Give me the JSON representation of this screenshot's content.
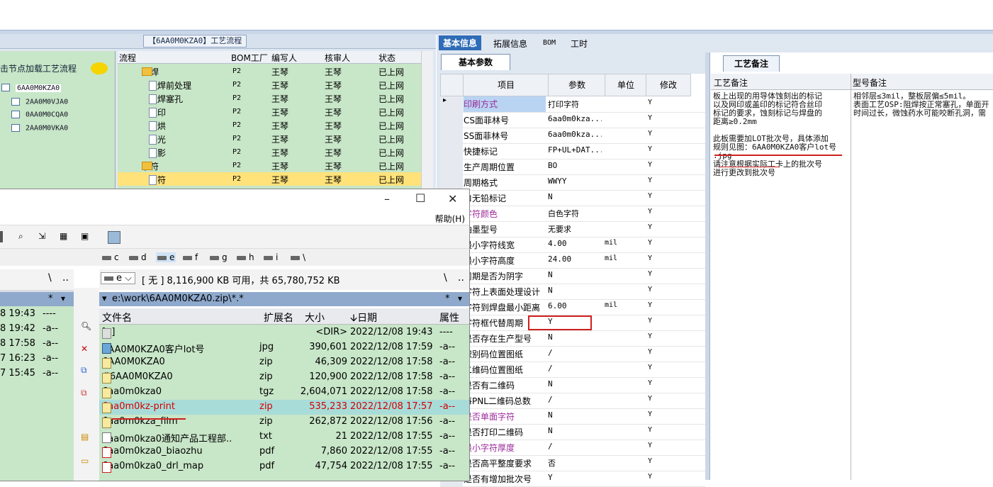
{
  "process_panel": {
    "title": "【6AA0M0KZA0】工艺流程",
    "left_hint": "击节点加载工艺流程",
    "tree": [
      "6AA0M0KZA0",
      "2AA0M0VJA0",
      "0AA0M0CQA0",
      "2AA0M0VKA0"
    ],
    "columns": [
      "流程",
      "BOM工厂",
      "编写人",
      "核审人",
      "状态"
    ],
    "rows": [
      {
        "name": "阻焊",
        "plant": "P2",
        "author": "王琴",
        "reviewer": "王琴",
        "status": "已上网"
      },
      {
        "name": "阻焊前处理",
        "plant": "P2",
        "author": "王琴",
        "reviewer": "王琴",
        "status": "已上网"
      },
      {
        "name": "阻焊塞孔",
        "plant": "P2",
        "author": "王琴",
        "reviewer": "王琴",
        "status": "已上网"
      },
      {
        "name": "丝印",
        "plant": "P2",
        "author": "王琴",
        "reviewer": "王琴",
        "status": "已上网"
      },
      {
        "name": "预烘",
        "plant": "P2",
        "author": "王琴",
        "reviewer": "王琴",
        "status": "已上网"
      },
      {
        "name": "曝光",
        "plant": "P2",
        "author": "王琴",
        "reviewer": "王琴",
        "status": "已上网"
      },
      {
        "name": "显影",
        "plant": "P2",
        "author": "王琴",
        "reviewer": "王琴",
        "status": "已上网"
      },
      {
        "name": "字符",
        "plant": "P2",
        "author": "王琴",
        "reviewer": "王琴",
        "status": "已上网"
      },
      {
        "name": "字符",
        "plant": "P2",
        "author": "王琴",
        "reviewer": "王琴",
        "status": "已上网"
      }
    ]
  },
  "file_manager": {
    "help_menu": "帮助(H)",
    "drives": [
      "c",
      "d",
      "e",
      "f",
      "g",
      "h",
      "i",
      "\\"
    ],
    "drive_select": "e",
    "free_space": "[ 无 ]  8,116,900 KB 可用，共 65,780,752 KB",
    "path": "e:\\work\\6AA0M0KZA0.zip\\*.*",
    "nav_root": "\\",
    "nav_up": "..",
    "filter": "*",
    "columns": {
      "name": "文件名",
      "ext": "扩展名",
      "size": "大小",
      "date": "日期",
      "attr": "属性"
    },
    "left_attr_header": "属性",
    "left_rows": [
      {
        "date": "8 19:43",
        "attr": "----"
      },
      {
        "date": "8 19:42",
        "attr": "-a--"
      },
      {
        "date": "8 17:58",
        "attr": "-a--"
      },
      {
        "date": "7 16:23",
        "attr": "-a--"
      },
      {
        "date": "7 15:45",
        "attr": "-a--"
      }
    ],
    "files": [
      {
        "name": "[..]",
        "ext": "",
        "size": "<DIR>",
        "date": "2022/12/08 19:43",
        "attr": "----"
      },
      {
        "name": "6AA0M0KZA0客户lot号",
        "ext": "jpg",
        "size": "390,601",
        "date": "2022/12/08 17:59",
        "attr": "-a--"
      },
      {
        "name": "6AA0M0KZA0",
        "ext": "zip",
        "size": "46,309",
        "date": "2022/12/08 17:58",
        "attr": "-a--"
      },
      {
        "name": "#6AA0M0KZA0",
        "ext": "zip",
        "size": "120,900",
        "date": "2022/12/08 17:58",
        "attr": "-a--"
      },
      {
        "name": "6aa0m0kza0",
        "ext": "tgz",
        "size": "2,604,071",
        "date": "2022/12/08 17:58",
        "attr": "-a--"
      },
      {
        "name": "6aa0m0kz-print",
        "ext": "zip",
        "size": "535,233",
        "date": "2022/12/08 17:57",
        "attr": "-a--"
      },
      {
        "name": "6aa0m0kza_film",
        "ext": "zip",
        "size": "262,872",
        "date": "2022/12/08 17:56",
        "attr": "-a--"
      },
      {
        "name": "6aa0m0kza0通知产品工程部..",
        "ext": "txt",
        "size": "21",
        "date": "2022/12/08 17:55",
        "attr": "-a--"
      },
      {
        "name": "6aa0m0kza0_biaozhu",
        "ext": "pdf",
        "size": "7,860",
        "date": "2022/12/08 17:55",
        "attr": "-a--"
      },
      {
        "name": "6aa0m0kza0_drl_map",
        "ext": "pdf",
        "size": "47,754",
        "date": "2022/12/08 17:55",
        "attr": "-a--"
      }
    ]
  },
  "params_panel": {
    "tabs": [
      "基本信息",
      "拓展信息",
      "BOM",
      "工时"
    ],
    "subtab": "基本参数",
    "columns": [
      "项目",
      "参数",
      "单位",
      "修改"
    ],
    "rows": [
      {
        "item": "印刷方式",
        "value": "打印字符",
        "unit": "",
        "mod": "Y",
        "purple": true
      },
      {
        "item": "CS面菲林号",
        "value": "6aa0m0kza...",
        "unit": "",
        "mod": "Y"
      },
      {
        "item": "SS面菲林号",
        "value": "6aa0m0kza...",
        "unit": "",
        "mod": "Y"
      },
      {
        "item": "快捷标记",
        "value": "FP+UL+DAT...",
        "unit": "",
        "mod": "Y"
      },
      {
        "item": "生产周期位置",
        "value": "BO",
        "unit": "",
        "mod": "Y"
      },
      {
        "item": "周期格式",
        "value": "WWYY",
        "unit": "",
        "mod": "Y"
      },
      {
        "item": "ロ无铅标记",
        "value": "N",
        "unit": "",
        "mod": "Y"
      },
      {
        "item": "字符颜色",
        "value": "白色字符",
        "unit": "",
        "mod": "Y",
        "purple": true
      },
      {
        "item": "油墨型号",
        "value": "无要求",
        "unit": "",
        "mod": "Y"
      },
      {
        "item": "最小字符线宽",
        "value": "4.00",
        "unit": "mil",
        "mod": "Y"
      },
      {
        "item": "最小字符高度",
        "value": "24.00",
        "unit": "mil",
        "mod": "Y"
      },
      {
        "item": "周期是否为阴字",
        "value": "N",
        "unit": "",
        "mod": "Y"
      },
      {
        "item": "字符上表面处理设计",
        "value": "N",
        "unit": "",
        "mod": "Y"
      },
      {
        "item": "字符到焊盘最小距离",
        "value": "6.00",
        "unit": "mil",
        "mod": "Y"
      },
      {
        "item": "字符框代替周期",
        "value": "Y",
        "unit": "",
        "mod": "Y"
      },
      {
        "item": "是否存在生产型号",
        "value": "N",
        "unit": "",
        "mod": "Y"
      },
      {
        "item": "识别码位置图纸",
        "value": "/",
        "unit": "",
        "mod": "Y"
      },
      {
        "item": "二维码位置图纸",
        "value": "/",
        "unit": "",
        "mod": "Y"
      },
      {
        "item": "是否有二维码",
        "value": "N",
        "unit": "",
        "mod": "Y"
      },
      {
        "item": "每PNL二维码总数",
        "value": "/",
        "unit": "",
        "mod": "Y"
      },
      {
        "item": "是否单面字符",
        "value": "N",
        "unit": "",
        "mod": "Y",
        "purple": true
      },
      {
        "item": "是否打印二维码",
        "value": "N",
        "unit": "",
        "mod": "Y"
      },
      {
        "item": "最小字符厚度",
        "value": "/",
        "unit": "",
        "mod": "Y",
        "purple": true
      },
      {
        "item": "是否高平整度要求",
        "value": "否",
        "unit": "",
        "mod": "Y"
      },
      {
        "item": "是否有增加批次号",
        "value": "Y",
        "unit": "",
        "mod": "Y"
      }
    ]
  },
  "notes_panel": {
    "tab": "工艺备注",
    "col1": "工艺备注",
    "col2": "型号备注",
    "note1": [
      "板上出现的用导体蚀刻出的标记",
      "以及网印或盖印的标记符合丝印",
      "标记的要求，蚀刻标记与焊盘的",
      "距离≥0.2mm",
      "",
      "此板需要加LOT批次号，具体添加",
      "规则见图：6AA0M0KZA0客户lot号",
      ".jpg",
      "请注意根据实际工卡上的批次号",
      "进行更改到批次号"
    ],
    "note2": [
      "相邻层≤3mil，整板层偏≤5mil。",
      "表面工艺OSP:阻焊按正常塞孔，单面开",
      "时间过长，微蚀药水可能咬断孔洞，需"
    ]
  },
  "colors": {
    "grid_green": "#c8e6c8",
    "selected_yellow": "#ffe27a",
    "accent_blue": "#2f6cb7",
    "highlight_red": "#d02020"
  }
}
